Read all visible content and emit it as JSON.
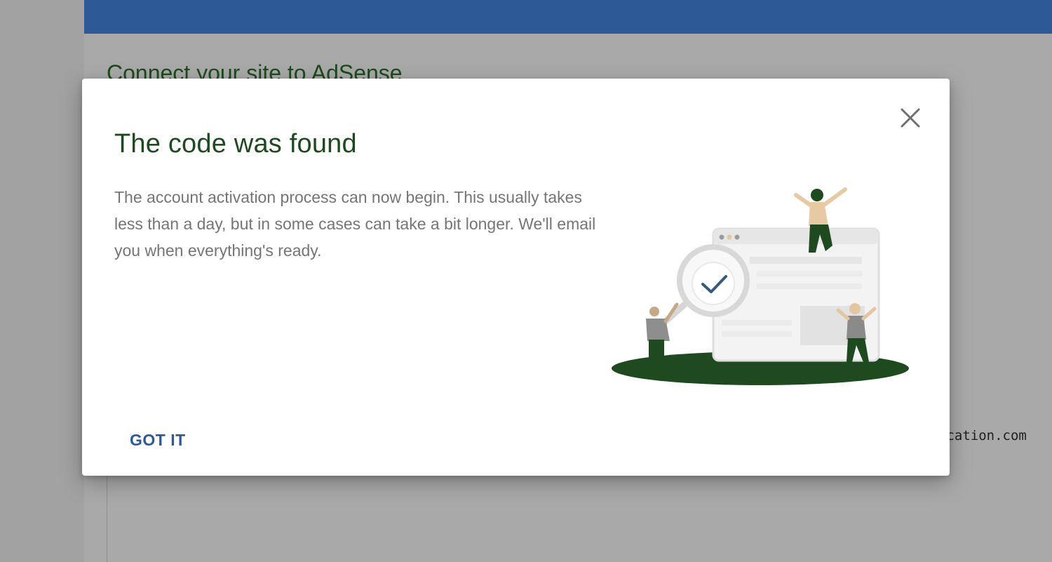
{
  "background": {
    "page_title": "Connect your site to AdSense",
    "code_snippet_fragment": "ication.com"
  },
  "dialog": {
    "title": "The code was found",
    "body": "The account activation process can now begin. This usually takes less than a day, but in some cases can take a bit longer. We'll email you when everything's ready.",
    "primary_button_label": "GOT IT",
    "close_icon": "close-icon",
    "illustration": "site-verified-illustration"
  },
  "colors": {
    "header_blue": "#2d5a96",
    "title_green": "#1f4a20",
    "body_gray": "#757575",
    "button_blue": "#2d5a96",
    "ground_green": "#1f4a20"
  }
}
